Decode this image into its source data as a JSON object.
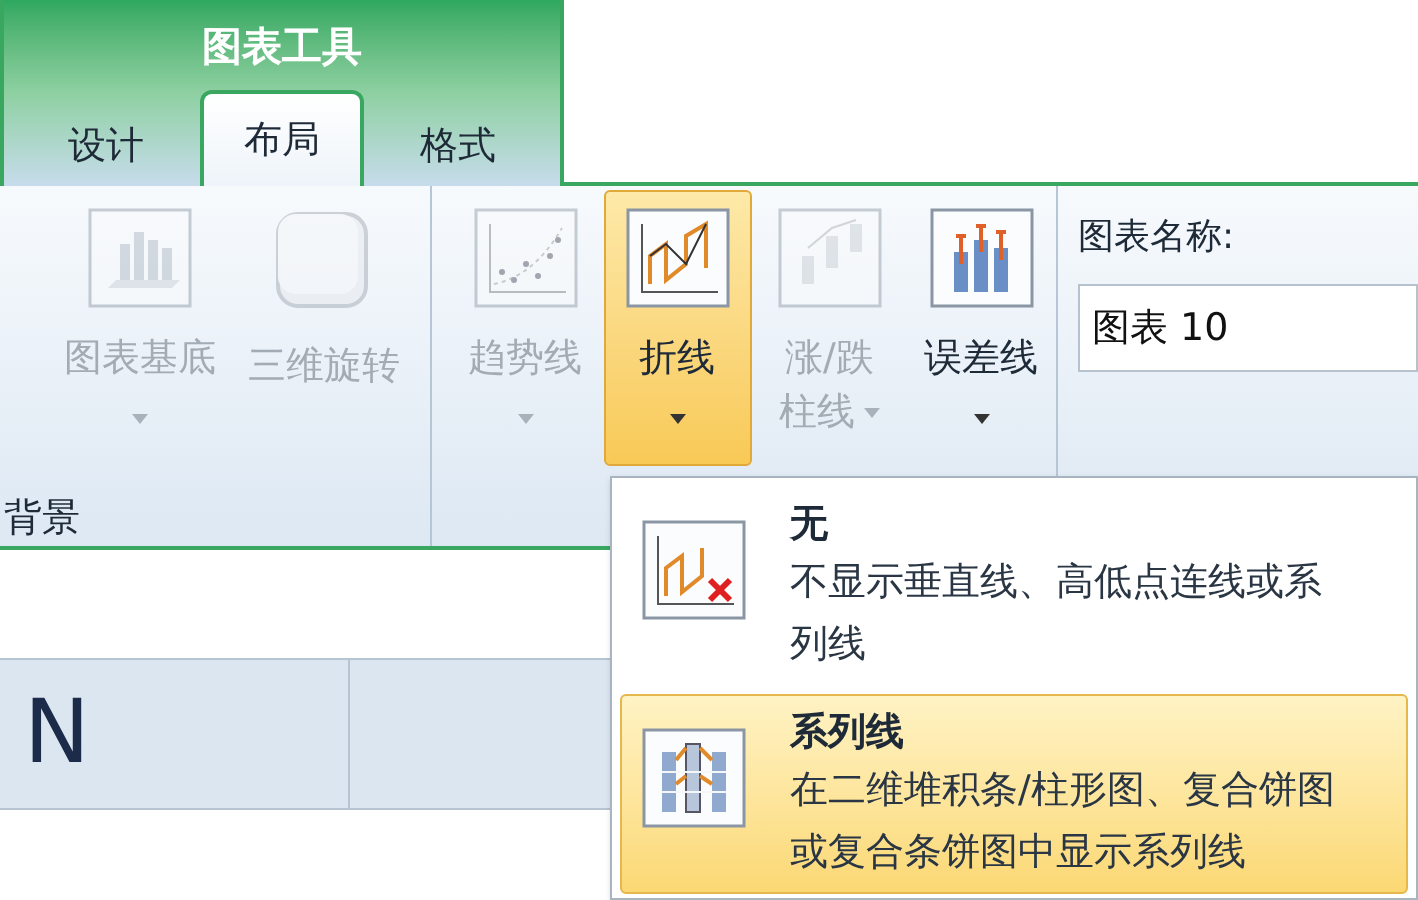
{
  "contextual_tab_group": {
    "title": "图表工具"
  },
  "tabs": [
    {
      "label": "设计",
      "selected": false
    },
    {
      "label": "布局",
      "selected": true
    },
    {
      "label": "格式",
      "selected": false
    }
  ],
  "ribbon": {
    "groups": [
      {
        "label": "背景",
        "buttons": [
          {
            "kind": "base",
            "lines": [
              "图表基底"
            ],
            "dropdown": true,
            "disabled": true,
            "selected": false
          },
          {
            "kind": "rotate",
            "lines": [
              "三维旋转"
            ],
            "dropdown": false,
            "disabled": true,
            "selected": false
          }
        ]
      },
      {
        "buttons": [
          {
            "kind": "trend",
            "lines": [
              "趋势线"
            ],
            "dropdown": true,
            "disabled": true,
            "selected": false
          },
          {
            "kind": "line",
            "lines": [
              "折线"
            ],
            "dropdown": true,
            "disabled": false,
            "selected": true
          },
          {
            "kind": "updown",
            "lines": [
              "涨/跌",
              "柱线"
            ],
            "dropdown": true,
            "disabled": true,
            "selected": false
          },
          {
            "kind": "error",
            "lines": [
              "误差线"
            ],
            "dropdown": true,
            "disabled": false,
            "selected": false
          }
        ]
      }
    ],
    "name_field": {
      "label": "图表名称:",
      "value": "图表 10"
    }
  },
  "sheet": {
    "column_headers": [
      "N"
    ]
  },
  "menu": {
    "items": [
      {
        "kind": "none",
        "title": "无",
        "description": "不显示垂直线、高低点连线或系列线",
        "selected": false
      },
      {
        "kind": "series",
        "title": "系列线",
        "description": "在二维堆积条/柱形图、复合饼图或复合条饼图中显示系列线",
        "selected": true
      }
    ]
  }
}
